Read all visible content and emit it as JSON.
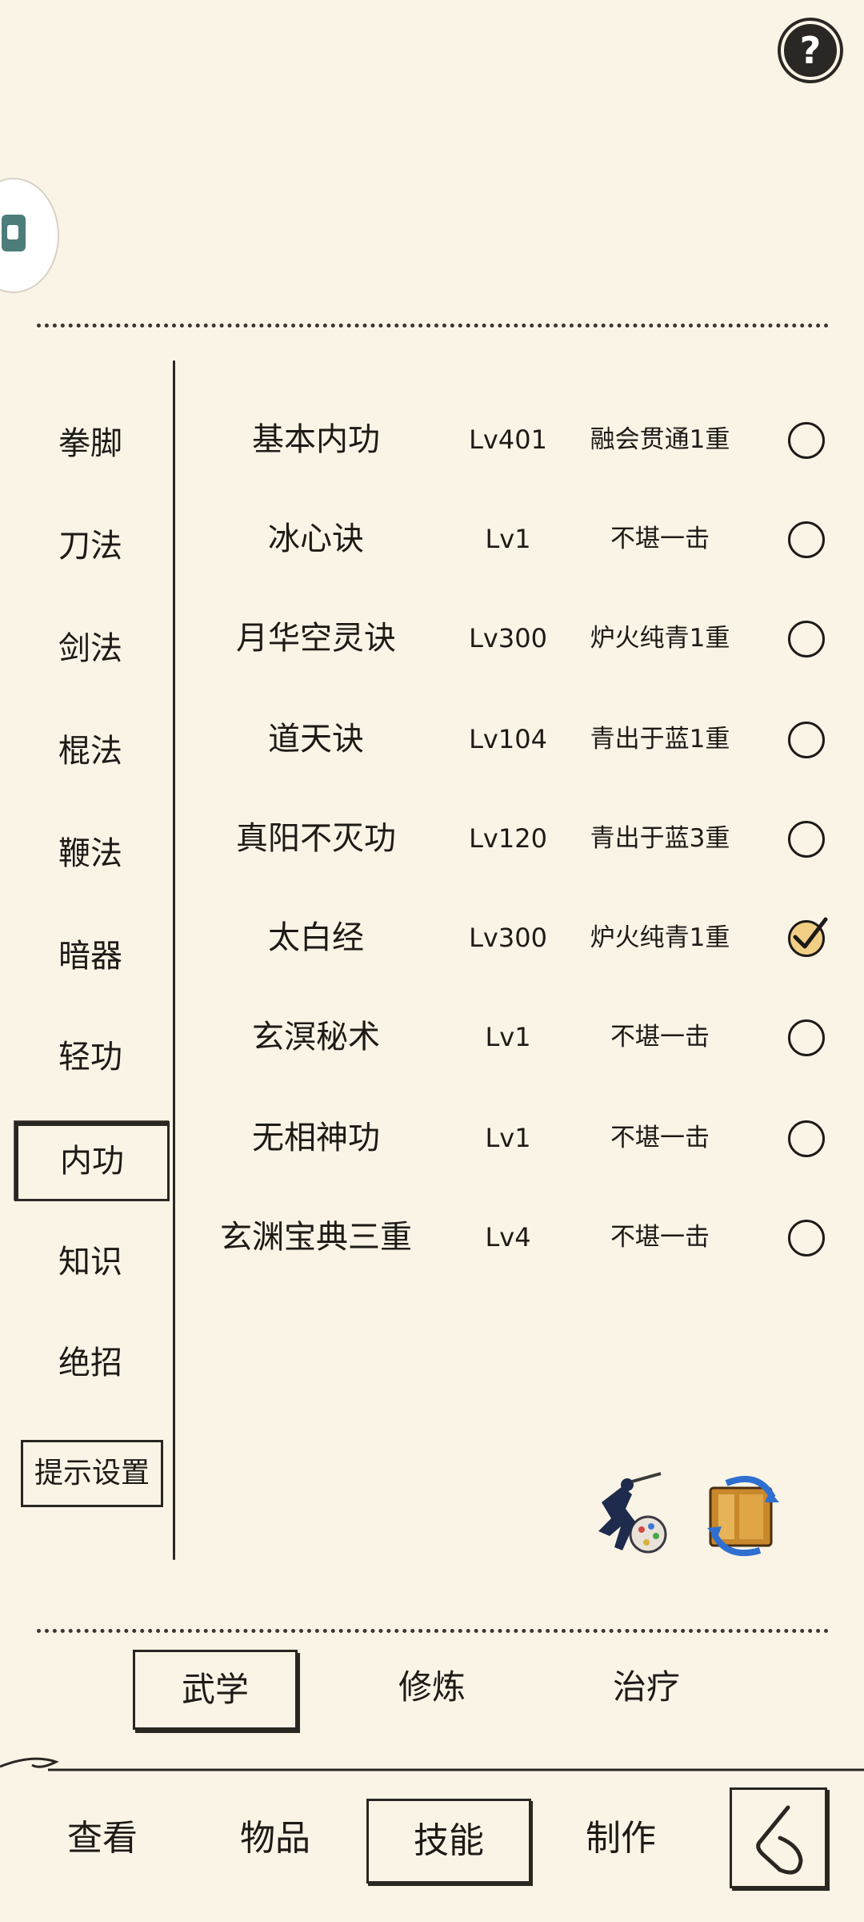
{
  "header": {
    "help_icon": "question-icon",
    "avatar_icon": "app-logo-icon"
  },
  "categories": [
    {
      "label": "拳脚",
      "active": false
    },
    {
      "label": "刀法",
      "active": false
    },
    {
      "label": "剑法",
      "active": false
    },
    {
      "label": "棍法",
      "active": false
    },
    {
      "label": "鞭法",
      "active": false
    },
    {
      "label": "暗器",
      "active": false
    },
    {
      "label": "轻功",
      "active": false
    },
    {
      "label": "内功",
      "active": true
    },
    {
      "label": "知识",
      "active": false
    },
    {
      "label": "绝招",
      "active": false
    }
  ],
  "hint_settings_label": "提示设置",
  "skills": [
    {
      "name": "基本内功",
      "level": "Lv401",
      "rank": "融会贯通1重",
      "checked": false
    },
    {
      "name": "冰心诀",
      "level": "Lv1",
      "rank": "不堪一击",
      "checked": false
    },
    {
      "name": "月华空灵诀",
      "level": "Lv300",
      "rank": "炉火纯青1重",
      "checked": false
    },
    {
      "name": "道天诀",
      "level": "Lv104",
      "rank": "青出于蓝1重",
      "checked": false
    },
    {
      "name": "真阳不灭功",
      "level": "Lv120",
      "rank": "青出于蓝3重",
      "checked": false
    },
    {
      "name": "太白经",
      "level": "Lv300",
      "rank": "炉火纯青1重",
      "checked": true
    },
    {
      "name": "玄溟秘术",
      "level": "Lv1",
      "rank": "不堪一击",
      "checked": false
    },
    {
      "name": "无相神功",
      "level": "Lv1",
      "rank": "不堪一击",
      "checked": false
    },
    {
      "name": "玄渊宝典三重",
      "level": "Lv4",
      "rank": "不堪一击",
      "checked": false
    }
  ],
  "action_icons": [
    "fighter-icon",
    "swap-book-icon"
  ],
  "subtabs": [
    {
      "label": "武学",
      "active": true
    },
    {
      "label": "修炼",
      "active": false
    },
    {
      "label": "治疗",
      "active": false
    }
  ],
  "bottom_nav": [
    {
      "label": "查看",
      "active": false
    },
    {
      "label": "物品",
      "active": false
    },
    {
      "label": "技能",
      "active": true
    },
    {
      "label": "制作",
      "active": false
    }
  ],
  "back_icon": "back-arrow-icon",
  "colors": {
    "background": "#faf4e6",
    "ink": "#1e1a16",
    "check_fill": "#f1cf85"
  }
}
